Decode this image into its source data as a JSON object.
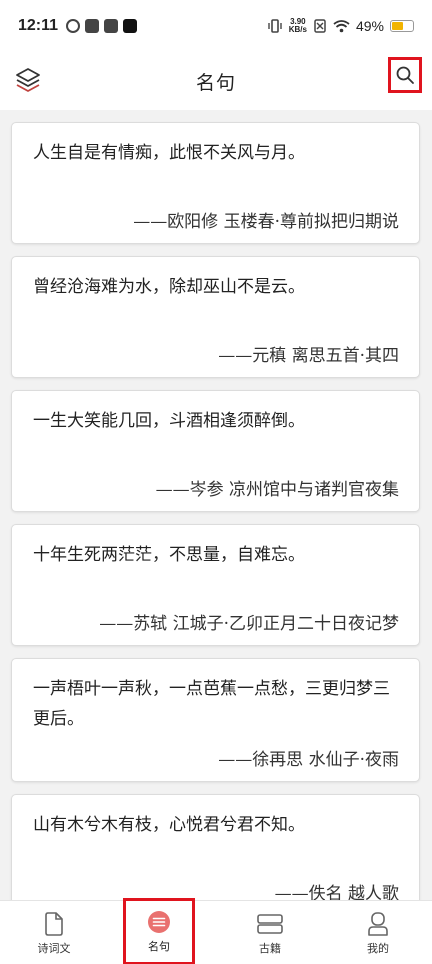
{
  "status_bar": {
    "time": "12:11",
    "net_speed_value": "3.90",
    "net_speed_unit": "KB/s",
    "battery_text": "49%",
    "battery_level": 0.49,
    "battery_color": "#f2b400"
  },
  "header": {
    "title": "名句",
    "left_icon": "layers-icon",
    "right_icon": "search-icon"
  },
  "quotes": [
    {
      "text": "人生自是有情痴，此恨不关风与月。",
      "source": "——欧阳修  玉楼春·尊前拟把归期说"
    },
    {
      "text": "曾经沧海难为水，除却巫山不是云。",
      "source": "——元稹  离思五首·其四"
    },
    {
      "text": "一生大笑能几回，斗酒相逢须醉倒。",
      "source": "——岑参  凉州馆中与诸判官夜集"
    },
    {
      "text": "十年生死两茫茫，不思量，自难忘。",
      "source": "——苏轼  江城子·乙卯正月二十日夜记梦"
    },
    {
      "text": "一声梧叶一声秋，一点芭蕉一点愁，三更归梦三更后。",
      "source": "——徐再思  水仙子·夜雨"
    },
    {
      "text": "山有木兮木有枝，心悦君兮君不知。",
      "source": "——佚名  越人歌"
    }
  ],
  "tabs": [
    {
      "label": "诗词文",
      "icon": "document-icon"
    },
    {
      "label": "名句",
      "icon": "list-icon"
    },
    {
      "label": "古籍",
      "icon": "book-icon"
    },
    {
      "label": "我的",
      "icon": "user-icon"
    }
  ],
  "colors": {
    "accent": "#e9716f",
    "highlight_box": "#e0141e"
  }
}
